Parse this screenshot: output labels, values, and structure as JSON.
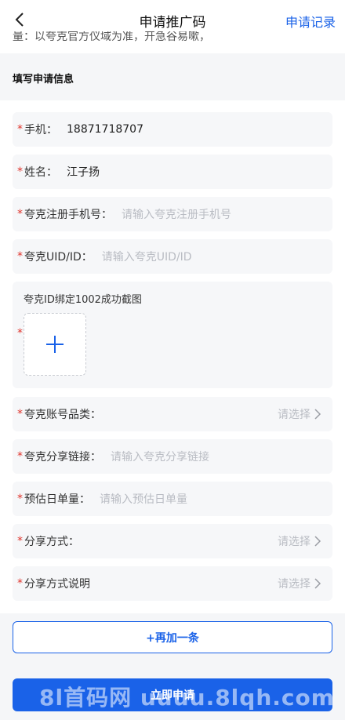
{
  "header": {
    "title": "申请推广码",
    "right_link": "申请记录"
  },
  "notice": "量：以夸克官方仪域为准，开急谷易嗽，",
  "section_title": "填写申请信息",
  "form": {
    "phone": {
      "label": "手机：",
      "value": "18871718707"
    },
    "name": {
      "label": "姓名：",
      "value": "江子扬"
    },
    "quark_phone": {
      "label": "夸克注册手机号：",
      "placeholder": "请输入夸克注册手机号"
    },
    "quark_uid": {
      "label": "夸克UID/ID：",
      "placeholder": "请输入夸克UID/ID"
    },
    "screenshot": {
      "label": "夸克ID绑定1002成功截图"
    },
    "account_category": {
      "label": "夸克账号品类：",
      "placeholder": "请选择"
    },
    "share_link": {
      "label": "夸克分享链接：",
      "placeholder": "请输入夸克分享链接"
    },
    "daily_volume": {
      "label": "预估日单量：",
      "placeholder": "请输入预估日单量"
    },
    "share_method": {
      "label": "分享方式：",
      "placeholder": "请选择"
    },
    "share_method_desc": {
      "label": "分享方式说明",
      "placeholder": "请选择"
    }
  },
  "buttons": {
    "add_more": "+再加一条",
    "submit": "立即申请"
  },
  "watermark": "8l首码网 uuuu.8lqh.com",
  "colors": {
    "accent": "#1a62e8",
    "required": "#e0332b",
    "field_bg": "#f6f7f9"
  }
}
